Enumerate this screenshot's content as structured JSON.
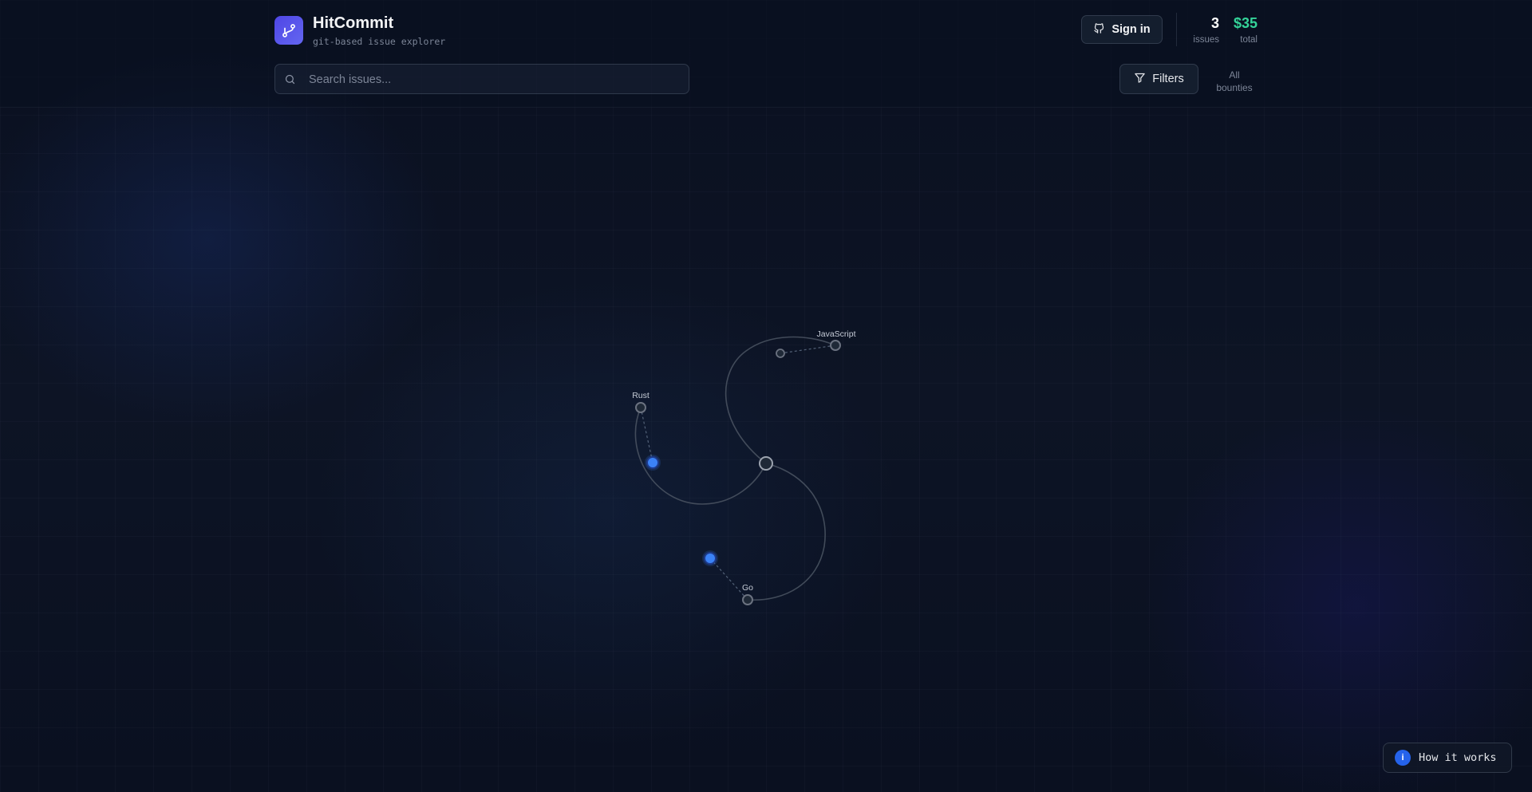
{
  "header": {
    "title": "HitCommit",
    "subtitle": "git-based issue explorer",
    "signin_label": "Sign in",
    "stats": {
      "issues_value": "3",
      "issues_label": "issues",
      "total_value": "$35",
      "total_label": "total"
    }
  },
  "search": {
    "placeholder": "Search issues...",
    "value": ""
  },
  "filters": {
    "label": "Filters",
    "bounty_scope_line1": "All",
    "bounty_scope_line2": "bounties"
  },
  "graph": {
    "labels": {
      "javascript": "JavaScript",
      "rust": "Rust",
      "go": "Go"
    }
  },
  "help": {
    "label": "How it works",
    "icon_text": "i"
  },
  "colors": {
    "accent": "#6366f1",
    "bounty_green": "#34d399",
    "issue_node_blue": "#3b82f6",
    "info_blue": "#2563eb"
  },
  "icons": {
    "logo": "git-branch-icon",
    "signin": "github-icon",
    "search": "search-icon",
    "filters": "filter-icon",
    "help": "info-icon"
  }
}
